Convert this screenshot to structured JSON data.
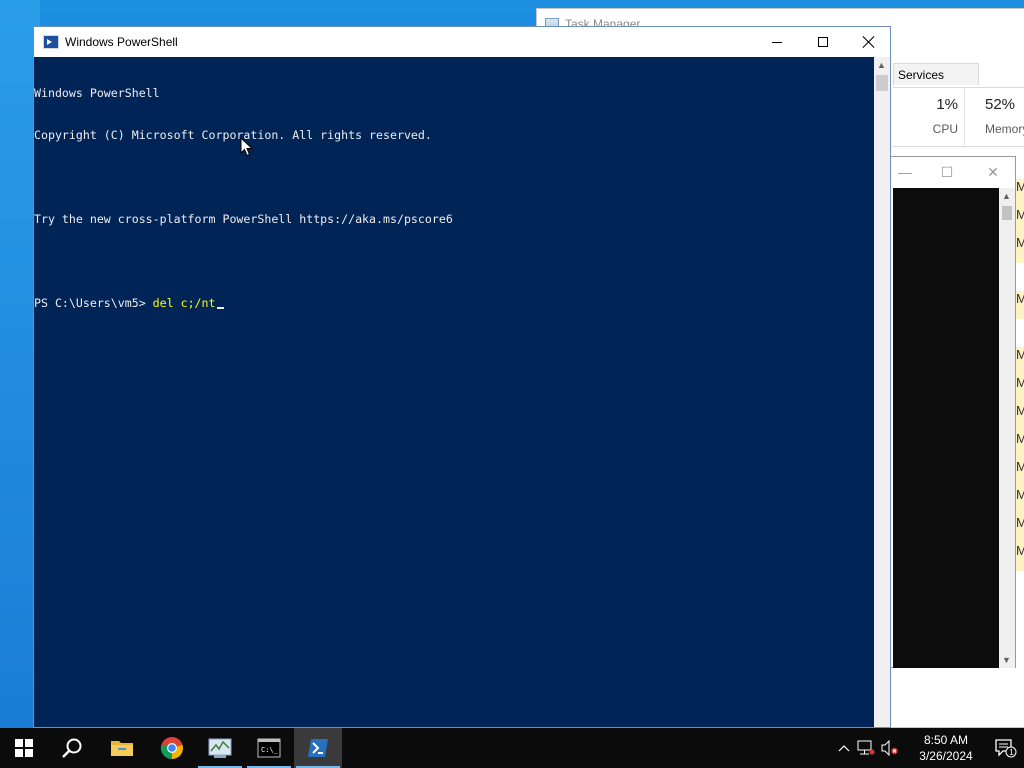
{
  "taskmanager": {
    "title": "Task Manager",
    "tab_services": "Services",
    "cpu": {
      "percent": "1%",
      "label": "CPU"
    },
    "memory": {
      "percent": "52%",
      "label": "Memory"
    },
    "rows_partial": [
      "M",
      "M",
      "M",
      "",
      "M",
      "",
      "M",
      "M",
      "M",
      "M",
      "M",
      "M",
      "M",
      "M"
    ]
  },
  "powershell": {
    "title": "Windows PowerShell",
    "lines": [
      "Windows PowerShell",
      "Copyright (C) Microsoft Corporation. All rights reserved.",
      "",
      "Try the new cross-platform PowerShell https://aka.ms/pscore6",
      ""
    ],
    "prompt": "PS C:\\Users\\vm5> ",
    "typed_command": "del c;/nt"
  },
  "taskbar": {
    "clock_time": "8:50 AM",
    "clock_date": "3/26/2024",
    "notification_count": "1",
    "apps": [
      {
        "name": "File Explorer",
        "icon": "folder-icon"
      },
      {
        "name": "Google Chrome",
        "icon": "chrome-icon"
      },
      {
        "name": "Task Manager",
        "icon": "taskmanager-icon"
      },
      {
        "name": "Command Prompt",
        "icon": "terminal-icon"
      },
      {
        "name": "Windows PowerShell",
        "icon": "powershell-icon",
        "active": true
      }
    ]
  },
  "colors": {
    "console_background": "#012456",
    "console_text": "#EEEDF0",
    "command_text": "#FFFF00",
    "desktop": "#1677D1",
    "taskbar": "#0B0B0B"
  }
}
